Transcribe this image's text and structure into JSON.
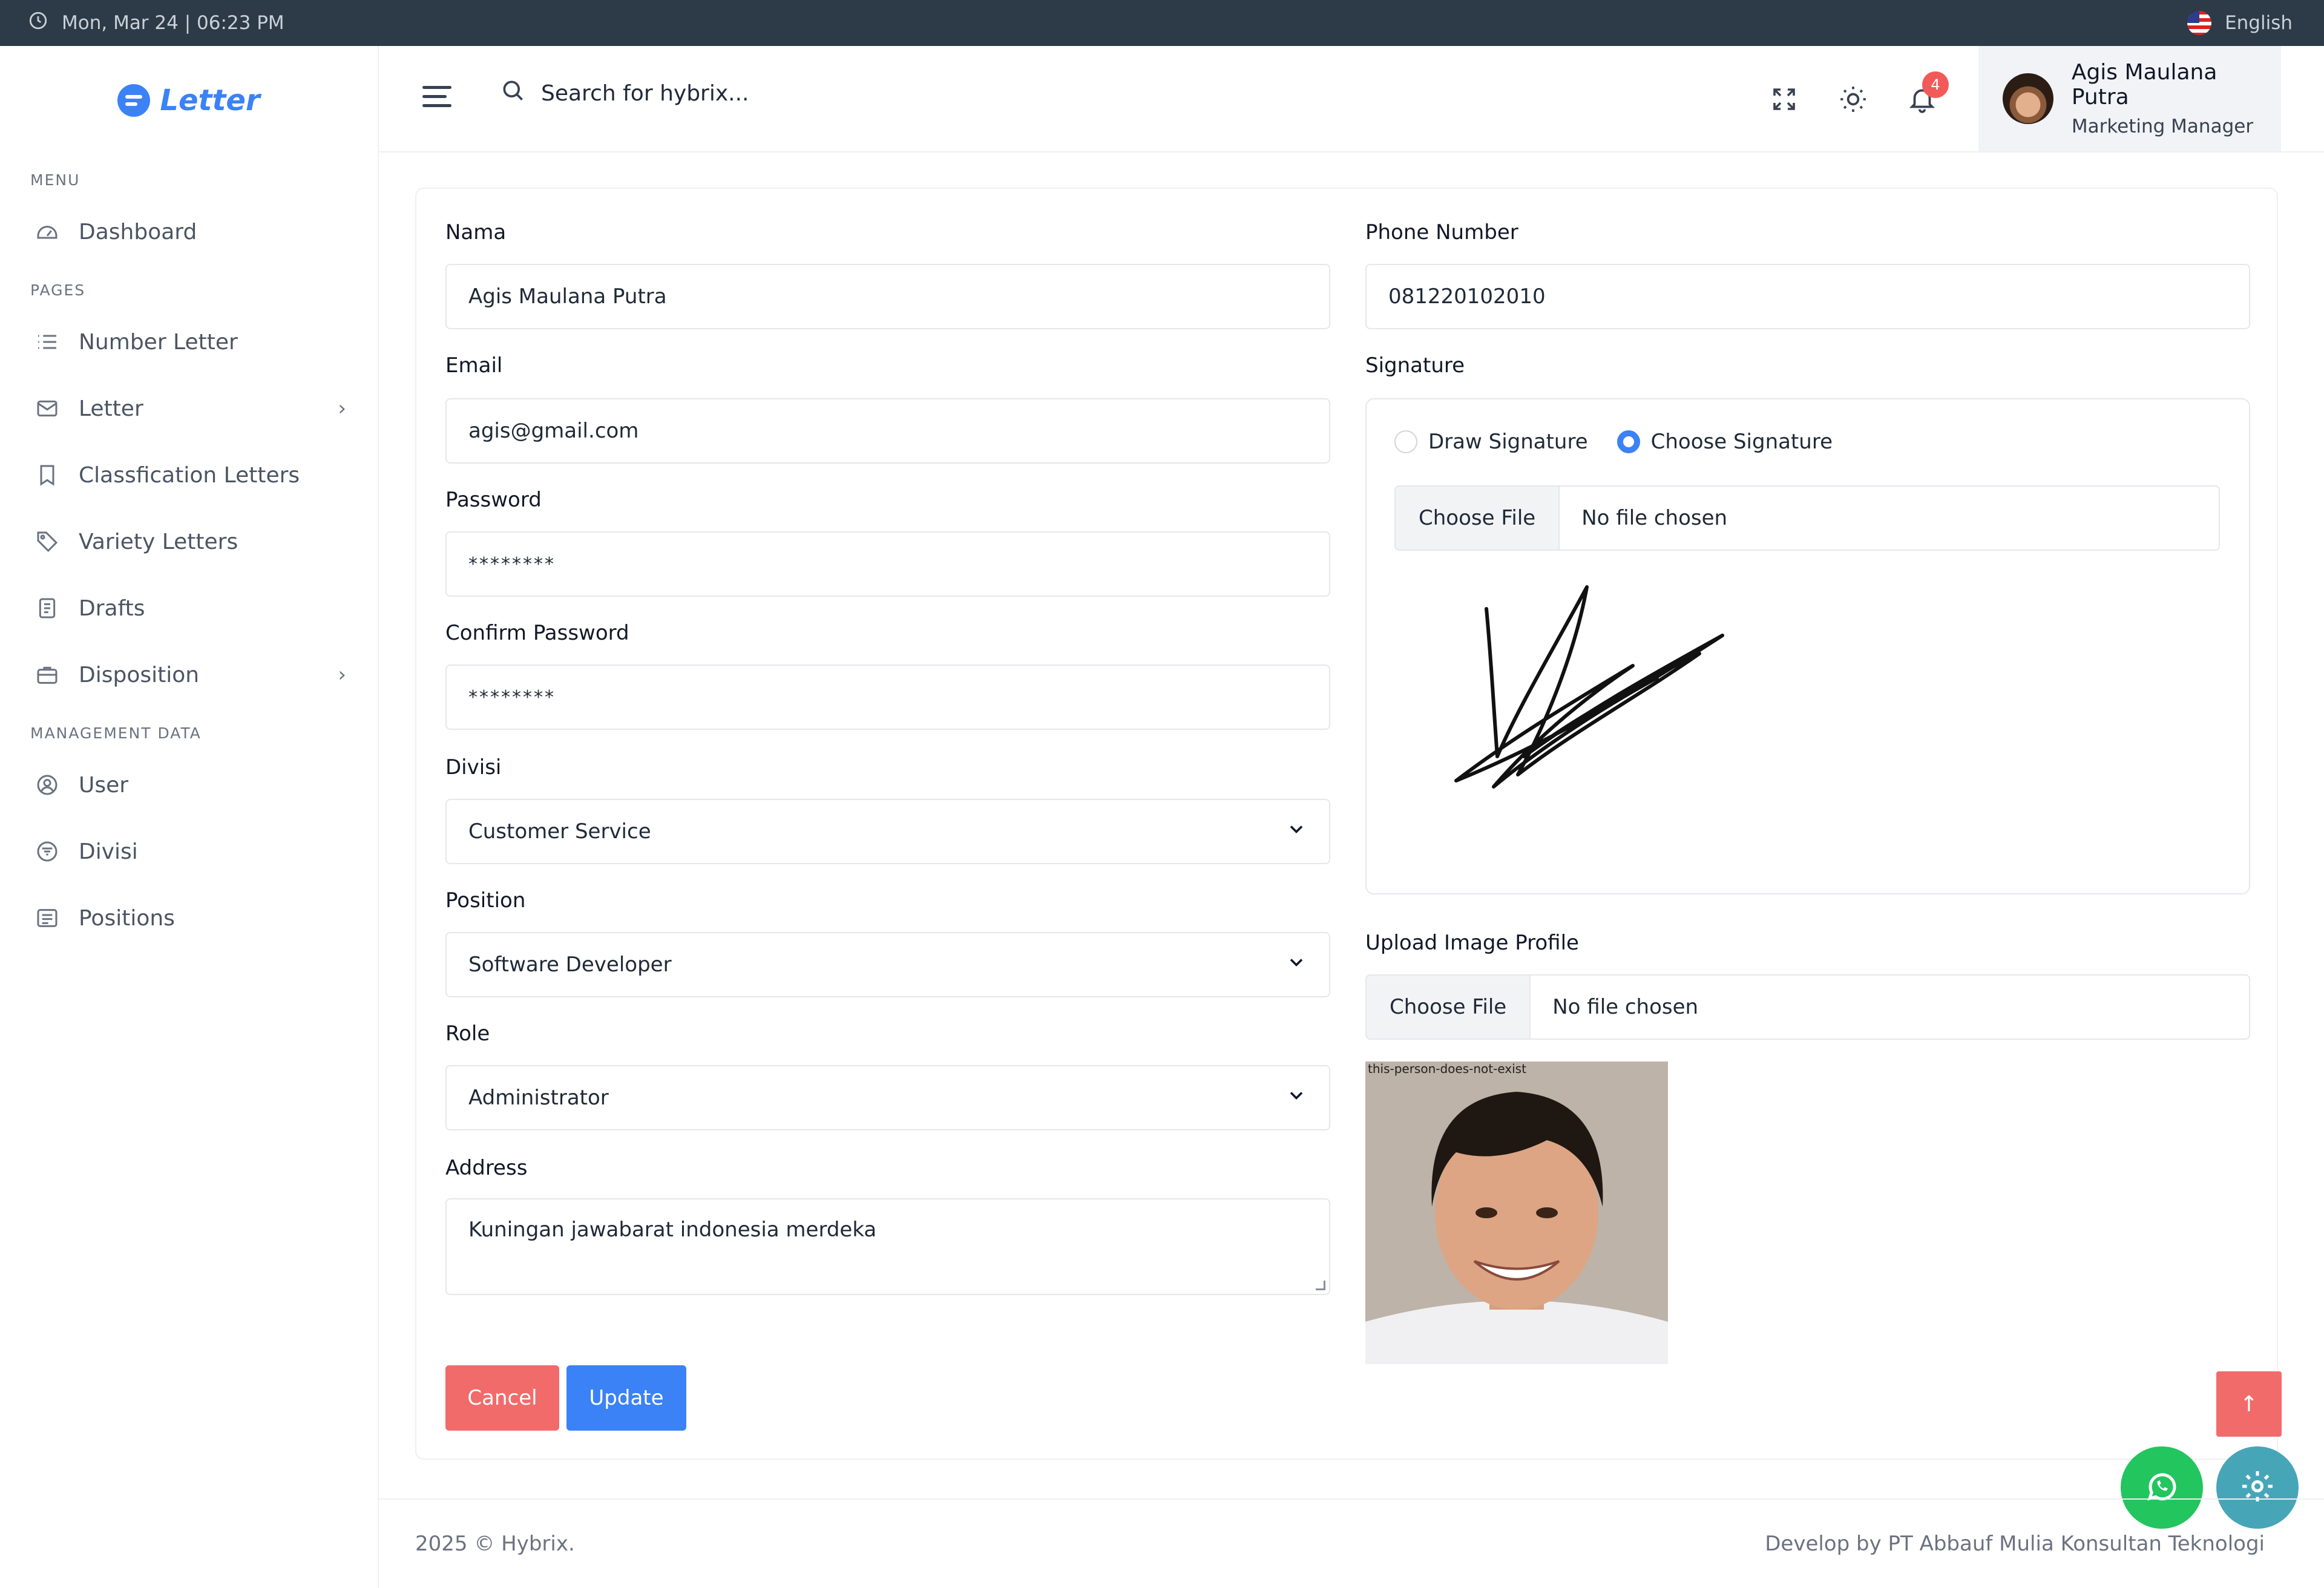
{
  "topbar": {
    "datetime": "Mon, Mar 24 | 06:23 PM",
    "language": "English"
  },
  "brand": {
    "name": "Letter"
  },
  "sidebar": {
    "sections": [
      {
        "title": "MENU",
        "items": [
          {
            "label": "Dashboard",
            "icon": "gauge-icon"
          }
        ]
      },
      {
        "title": "PAGES",
        "items": [
          {
            "label": "Number Letter",
            "icon": "list-icon"
          },
          {
            "label": "Letter",
            "icon": "mail-icon",
            "has_submenu": true
          },
          {
            "label": "Classfication Letters",
            "icon": "bookmark-icon"
          },
          {
            "label": "Variety Letters",
            "icon": "tag-icon"
          },
          {
            "label": "Drafts",
            "icon": "document-icon"
          },
          {
            "label": "Disposition",
            "icon": "briefcase-icon",
            "has_submenu": true
          }
        ]
      },
      {
        "title": "MANAGEMENT DATA",
        "items": [
          {
            "label": "User",
            "icon": "user-circle-icon"
          },
          {
            "label": "Divisi",
            "icon": "filter-icon"
          },
          {
            "label": "Positions",
            "icon": "list-box-icon"
          }
        ]
      }
    ]
  },
  "header": {
    "search_placeholder": "Search for hybrix...",
    "notification_count": "4",
    "user": {
      "name": "Agis Maulana Putra",
      "role": "Marketing Manager"
    }
  },
  "form": {
    "nama": {
      "label": "Nama",
      "value": "Agis Maulana Putra"
    },
    "email": {
      "label": "Email",
      "value": "agis@gmail.com"
    },
    "password": {
      "label": "Password",
      "value": "********"
    },
    "confirm_password": {
      "label": "Confirm Password",
      "value": "********"
    },
    "divisi": {
      "label": "Divisi",
      "value": "Customer Service"
    },
    "position": {
      "label": "Position",
      "value": "Software Developer"
    },
    "role": {
      "label": "Role",
      "value": "Administrator"
    },
    "address": {
      "label": "Address",
      "value": "Kuningan jawabarat indonesia merdeka"
    },
    "phone": {
      "label": "Phone Number",
      "value": "081220102010"
    },
    "signature": {
      "label": "Signature",
      "options": [
        "Draw Signature",
        "Choose Signature"
      ],
      "selected": "Choose Signature",
      "file_button": "Choose File",
      "file_status": "No file chosen"
    },
    "profile_image": {
      "label": "Upload Image Profile",
      "file_button": "Choose File",
      "file_status": "No file chosen",
      "watermark": "this-person-does-not-exist"
    },
    "buttons": {
      "cancel": "Cancel",
      "update": "Update"
    }
  },
  "footer": {
    "left": "2025 © Hybrix.",
    "right": "Develop by PT Abbauf Mulia Konsultan Teknologi"
  },
  "colors": {
    "primary": "#3b82f6",
    "danger": "#f16b6b",
    "topbar": "#2d3a47",
    "whatsapp": "#22c55e",
    "settings": "#46a6b7"
  }
}
